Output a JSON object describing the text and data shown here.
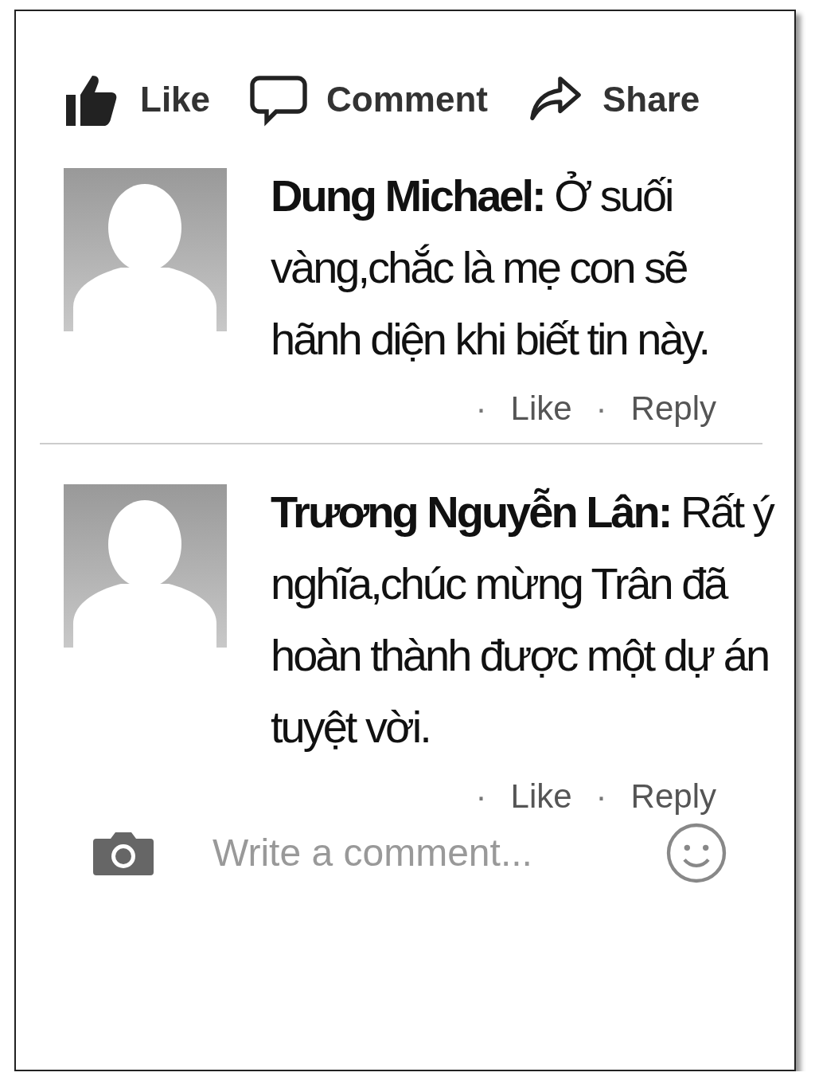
{
  "actions": [
    {
      "kind": "like",
      "label": "Like"
    },
    {
      "kind": "comment",
      "label": "Comment"
    },
    {
      "kind": "share",
      "label": "Share"
    }
  ],
  "comments": [
    {
      "author": "Dung Michael:",
      "text": "Ở suối vàng,chắc là mẹ con sẽ hãnh diện khi biết tin này.",
      "links": [
        {
          "bullet": "·",
          "label": "Like"
        },
        {
          "bullet": "·",
          "label": "Reply"
        }
      ]
    },
    {
      "author": "Trương Nguyễn Lân:",
      "text": "Rất ý nghĩa,chúc mừng Trân đã hoàn thành được một dự án tuyệt vời.",
      "links": [
        {
          "bullet": "·",
          "label": "Like"
        },
        {
          "bullet": "·",
          "label": "Reply"
        }
      ]
    }
  ],
  "composer": {
    "placeholder": "Write a comment..."
  }
}
